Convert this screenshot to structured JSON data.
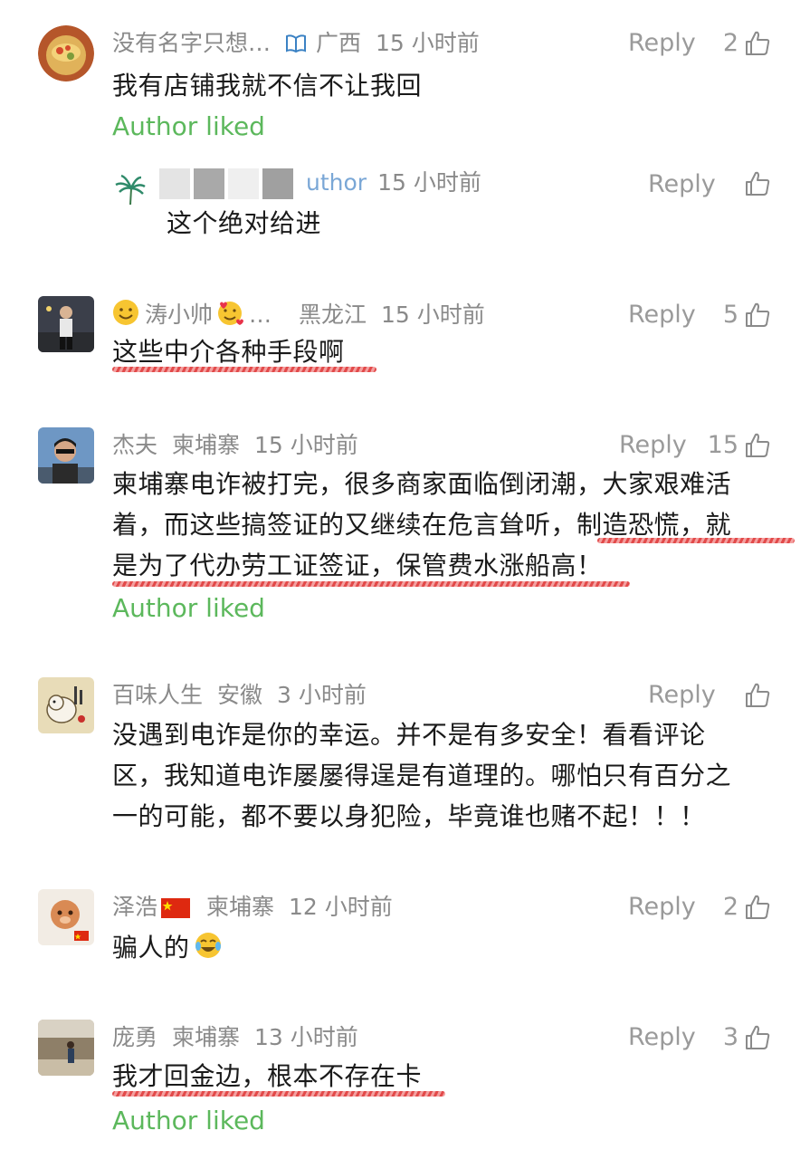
{
  "comments": [
    {
      "user": "没有名字只想…",
      "location": "广西",
      "time": "15 小时前",
      "reply": "Reply",
      "likes": "2",
      "text": "我有店铺我就不信不让我回",
      "author_liked": "Author liked",
      "verified_icon": "book-icon",
      "reply_comment": {
        "user_suffix": "uthor",
        "time": "15 小时前",
        "reply": "Reply",
        "text": "这个绝对给进"
      }
    },
    {
      "user": "涛小帅",
      "user_ellipsis": "…",
      "location": "黑龙江",
      "time": "15 小时前",
      "reply": "Reply",
      "likes": "5",
      "text": "这些中介各种手段啊"
    },
    {
      "user": "杰夫",
      "location": "柬埔寨",
      "time": "15 小时前",
      "reply": "Reply",
      "likes": "15",
      "text_lines": [
        "柬埔寨电诈被打完，很多商家面临倒闭潮，大家艰难活",
        "着，而这些搞签证的又继续在危言耸听，制造恐慌，就",
        "是为了代办劳工证签证，保管费水涨船高！"
      ],
      "author_liked": "Author liked"
    },
    {
      "user": "百味人生",
      "location": "安徽",
      "time": "3 小时前",
      "reply": "Reply",
      "text_lines": [
        "没遇到电诈是你的幸运。并不是有多安全！看看评论",
        "区，我知道电诈屡屡得逞是有道理的。哪怕只有百分之",
        "一的可能，都不要以身犯险，毕竟谁也赌不起！！！"
      ]
    },
    {
      "user": "泽浩",
      "location": "柬埔寨",
      "time": "12 小时前",
      "reply": "Reply",
      "likes": "2",
      "text": "骗人的"
    },
    {
      "user": "庞勇",
      "location": "柬埔寨",
      "time": "13 小时前",
      "reply": "Reply",
      "likes": "3",
      "text": "我才回金边，根本不存在卡",
      "author_liked": "Author liked"
    }
  ],
  "colors": {
    "liked_green": "#5cb85c",
    "meta_gray": "#8a8a8a",
    "underline_red": "#e24a4a"
  }
}
